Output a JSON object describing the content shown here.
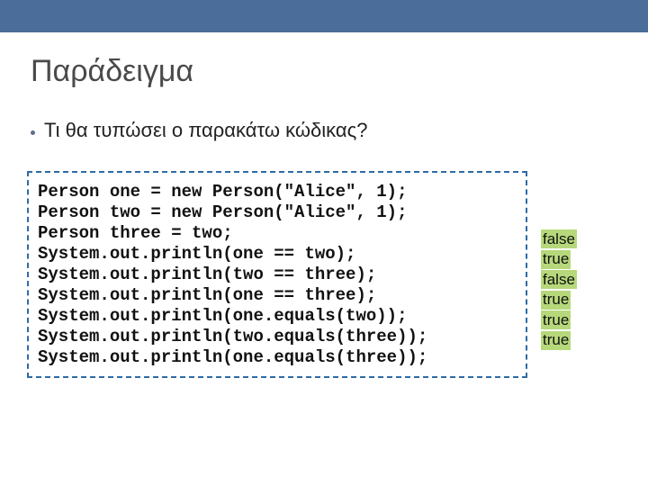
{
  "accent_blue": "#4a6d99",
  "title": "Παράδειγμα",
  "bullet": "Τι θα τυπώσει ο παρακάτω κώδικας?",
  "code": [
    "Person one = new Person(\"Alice\", 1);",
    "Person two = new Person(\"Alice\", 1);",
    "Person three = two;",
    "System.out.println(one == two);",
    "System.out.println(two == three);",
    "System.out.println(one == three);",
    "System.out.println(one.equals(two));",
    "System.out.println(two.equals(three));",
    "System.out.println(one.equals(three));"
  ],
  "outputs": [
    "false",
    "true",
    "false",
    "true",
    "true",
    "true"
  ]
}
